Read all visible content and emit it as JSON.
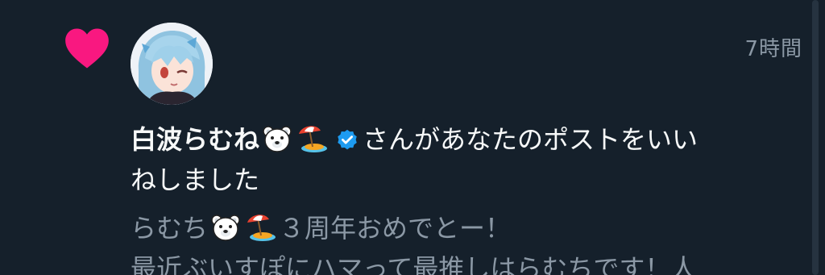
{
  "notification": {
    "icon": "heart-icon",
    "icon_color": "#f91880",
    "timestamp": "7時間",
    "user": {
      "name": "白波らむね",
      "emojis": [
        "polar-bear-emoji",
        "beach-umbrella-emoji"
      ],
      "verified": true,
      "verified_color": "#1d9bf0"
    },
    "action_text_1": "さんがあなたのポストをいい",
    "action_text_2": "ねしました",
    "post": {
      "line1_prefix": "らむち",
      "line1_emojis": [
        "polar-bear-emoji",
        "beach-umbrella-emoji"
      ],
      "line1_suffix": "３周年おめでとー！",
      "line2": "最近ぶいすぽにハマって最推しはらむちです！人"
    }
  },
  "colors": {
    "background": "#15202b",
    "primary_text": "#f7f9f9",
    "secondary_text": "#8b98a5"
  }
}
